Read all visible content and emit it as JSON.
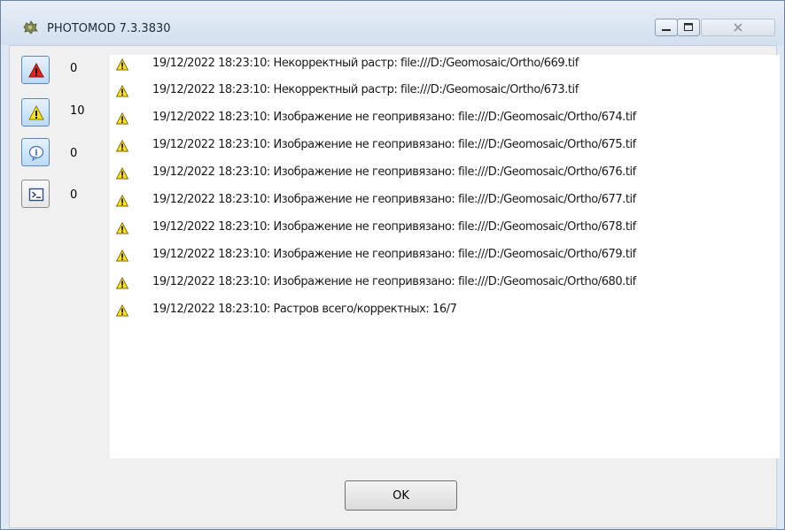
{
  "window": {
    "title": "PHOTOMOD 7.3.3830",
    "app_icon": "photomod-logo-icon",
    "controls": [
      "minimize-icon",
      "maximize-icon",
      "close-icon"
    ]
  },
  "filters": [
    {
      "name": "errors",
      "icon": "error-triangle-icon",
      "count": "0",
      "active": true
    },
    {
      "name": "warnings",
      "icon": "warning-triangle-icon",
      "count": "10",
      "active": true
    },
    {
      "name": "info",
      "icon": "info-icon",
      "count": "0",
      "active": true
    },
    {
      "name": "console",
      "icon": "console-icon",
      "count": "0",
      "active": false
    }
  ],
  "log": [
    {
      "icon": "warning-icon",
      "text": "19/12/2022 18:23:10: Некорректный растр: file:///D:/Geomosaic/Ortho/669.tif"
    },
    {
      "icon": "warning-icon",
      "text": "19/12/2022 18:23:10: Некорректный растр: file:///D:/Geomosaic/Ortho/673.tif"
    },
    {
      "icon": "warning-icon",
      "text": "19/12/2022 18:23:10: Изображение не геопривязано: file:///D:/Geomosaic/Ortho/674.tif"
    },
    {
      "icon": "warning-icon",
      "text": "19/12/2022 18:23:10: Изображение не геопривязано: file:///D:/Geomosaic/Ortho/675.tif"
    },
    {
      "icon": "warning-icon",
      "text": "19/12/2022 18:23:10: Изображение не геопривязано: file:///D:/Geomosaic/Ortho/676.tif"
    },
    {
      "icon": "warning-icon",
      "text": "19/12/2022 18:23:10: Изображение не геопривязано: file:///D:/Geomosaic/Ortho/677.tif"
    },
    {
      "icon": "warning-icon",
      "text": "19/12/2022 18:23:10: Изображение не геопривязано: file:///D:/Geomosaic/Ortho/678.tif"
    },
    {
      "icon": "warning-icon",
      "text": "19/12/2022 18:23:10: Изображение не геопривязано: file:///D:/Geomosaic/Ortho/679.tif"
    },
    {
      "icon": "warning-icon",
      "text": "19/12/2022 18:23:10: Изображение не геопривязано: file:///D:/Geomosaic/Ortho/680.tif"
    },
    {
      "icon": "warning-icon",
      "text": "19/12/2022 18:23:10: Растров всего/корректных: 16/7"
    }
  ],
  "ok_label": "OK"
}
